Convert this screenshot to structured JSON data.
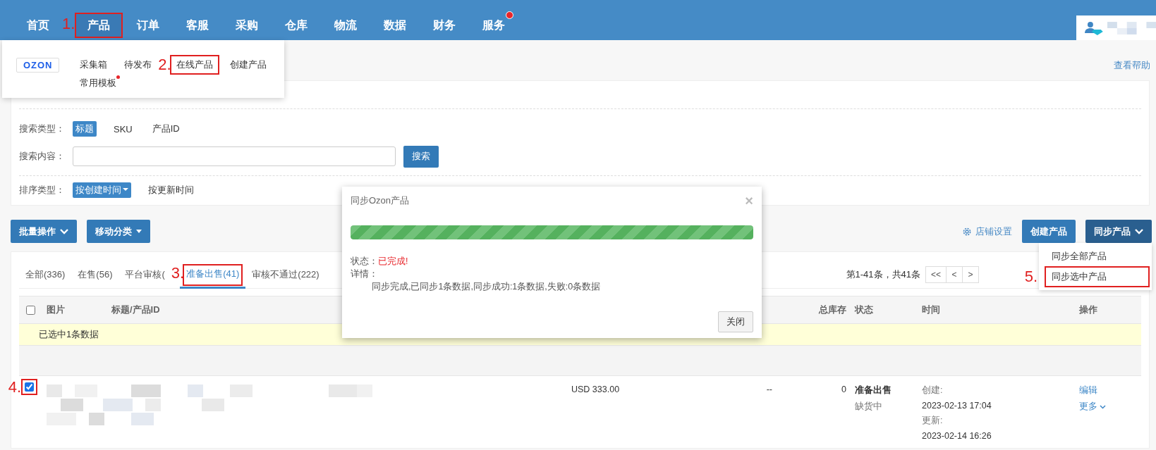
{
  "nav": {
    "items": [
      {
        "label": "首页",
        "selected": false,
        "highlighted": false,
        "dot": false
      },
      {
        "label": "产品",
        "selected": true,
        "highlighted": true,
        "marker": "1.",
        "dot": false
      },
      {
        "label": "订单",
        "selected": false,
        "highlighted": false,
        "dot": false
      },
      {
        "label": "客服",
        "selected": false,
        "highlighted": false,
        "dot": false
      },
      {
        "label": "采购",
        "selected": false,
        "highlighted": false,
        "dot": false
      },
      {
        "label": "仓库",
        "selected": false,
        "highlighted": false,
        "dot": false
      },
      {
        "label": "物流",
        "selected": false,
        "highlighted": false,
        "dot": false
      },
      {
        "label": "数据",
        "selected": false,
        "highlighted": false,
        "dot": false
      },
      {
        "label": "财务",
        "selected": false,
        "highlighted": false,
        "dot": false
      },
      {
        "label": "服务",
        "selected": false,
        "highlighted": false,
        "dot": true
      }
    ]
  },
  "product_menu": {
    "logo": "OZON",
    "items": [
      {
        "label": "采集箱",
        "highlighted": false,
        "dot": false
      },
      {
        "label": "待发布",
        "highlighted": false,
        "dot": false
      },
      {
        "label": "在线产品",
        "highlighted": true,
        "marker": "2.",
        "dot": false
      },
      {
        "label": "创建产品",
        "highlighted": false,
        "dot": false
      },
      {
        "label": "常用模板",
        "highlighted": false,
        "dot": true
      }
    ]
  },
  "help_link": "查看帮助",
  "filters": {
    "search_type": {
      "label": "搜索类型：",
      "options": [
        {
          "label": "标题",
          "selected": true
        },
        {
          "label": "SKU",
          "selected": false
        },
        {
          "label": "产品ID",
          "selected": false
        }
      ]
    },
    "search_content": {
      "label": "搜索内容：",
      "button": "搜索"
    },
    "sort": {
      "label": "排序类型：",
      "options": [
        {
          "label": "按创建时间",
          "selected": true
        },
        {
          "label": "按更新时间",
          "selected": false
        }
      ]
    }
  },
  "toolbar": {
    "left_buttons": [
      {
        "label": "批量操作",
        "kind": "chevron"
      },
      {
        "label": "移动分类",
        "kind": "caret"
      }
    ],
    "settings_link": "店铺设置",
    "create_button": "创建产品",
    "sync_button": {
      "label": "同步产品",
      "expanded": true
    },
    "sync_menu": [
      {
        "label": "同步全部产品",
        "highlighted": false
      },
      {
        "label": "同步选中产品",
        "highlighted": true,
        "marker": "5."
      }
    ]
  },
  "tabs": [
    {
      "label": "全部(336)",
      "selected": false,
      "highlighted": false
    },
    {
      "label": "在售(56)",
      "selected": false,
      "highlighted": false
    },
    {
      "label": "平台审核(",
      "selected": false,
      "highlighted": false
    },
    {
      "label": "准备出售(41)",
      "selected": true,
      "highlighted": true,
      "marker": "3."
    },
    {
      "label": "审核不通过(222)",
      "selected": false,
      "highlighted": false
    }
  ],
  "pagination": {
    "summary": "第1-41条，共41条",
    "buttons": [
      "<<",
      "<",
      ">"
    ]
  },
  "table": {
    "header_checked": false,
    "columns": [
      {
        "label": "图片"
      },
      {
        "label": "标题/产品ID",
        "kind": "title"
      },
      {
        "label": "总库存",
        "kind": "stock"
      },
      {
        "label": "状态",
        "kind": "status"
      },
      {
        "label": "时间",
        "kind": "time"
      },
      {
        "label": "操作",
        "kind": "actions"
      }
    ],
    "selection_notice": "已选中1条数据",
    "rows": [
      {
        "checked": true,
        "highlighted": true,
        "marker": "4.",
        "price": "USD 333.00",
        "column_5": "--",
        "stock": "0",
        "status": "准备出售",
        "stock_status": "缺货中",
        "created_label": "创建:",
        "created": "2023-02-13 17:04",
        "updated_label": "更新:",
        "updated": "2023-02-14 16:26",
        "actions": [
          {
            "label": "编辑",
            "caret": false
          },
          {
            "label": "更多",
            "caret": true
          }
        ]
      }
    ]
  },
  "modal": {
    "title": "同步Ozon产品",
    "close": "×",
    "level": 1,
    "status_label": "状态：",
    "status": "已完成!",
    "detail_label": "详情：",
    "detail": "同步完成,已同步1条数据,同步成功:1条数据,失败:0条数据",
    "button": "关闭"
  }
}
